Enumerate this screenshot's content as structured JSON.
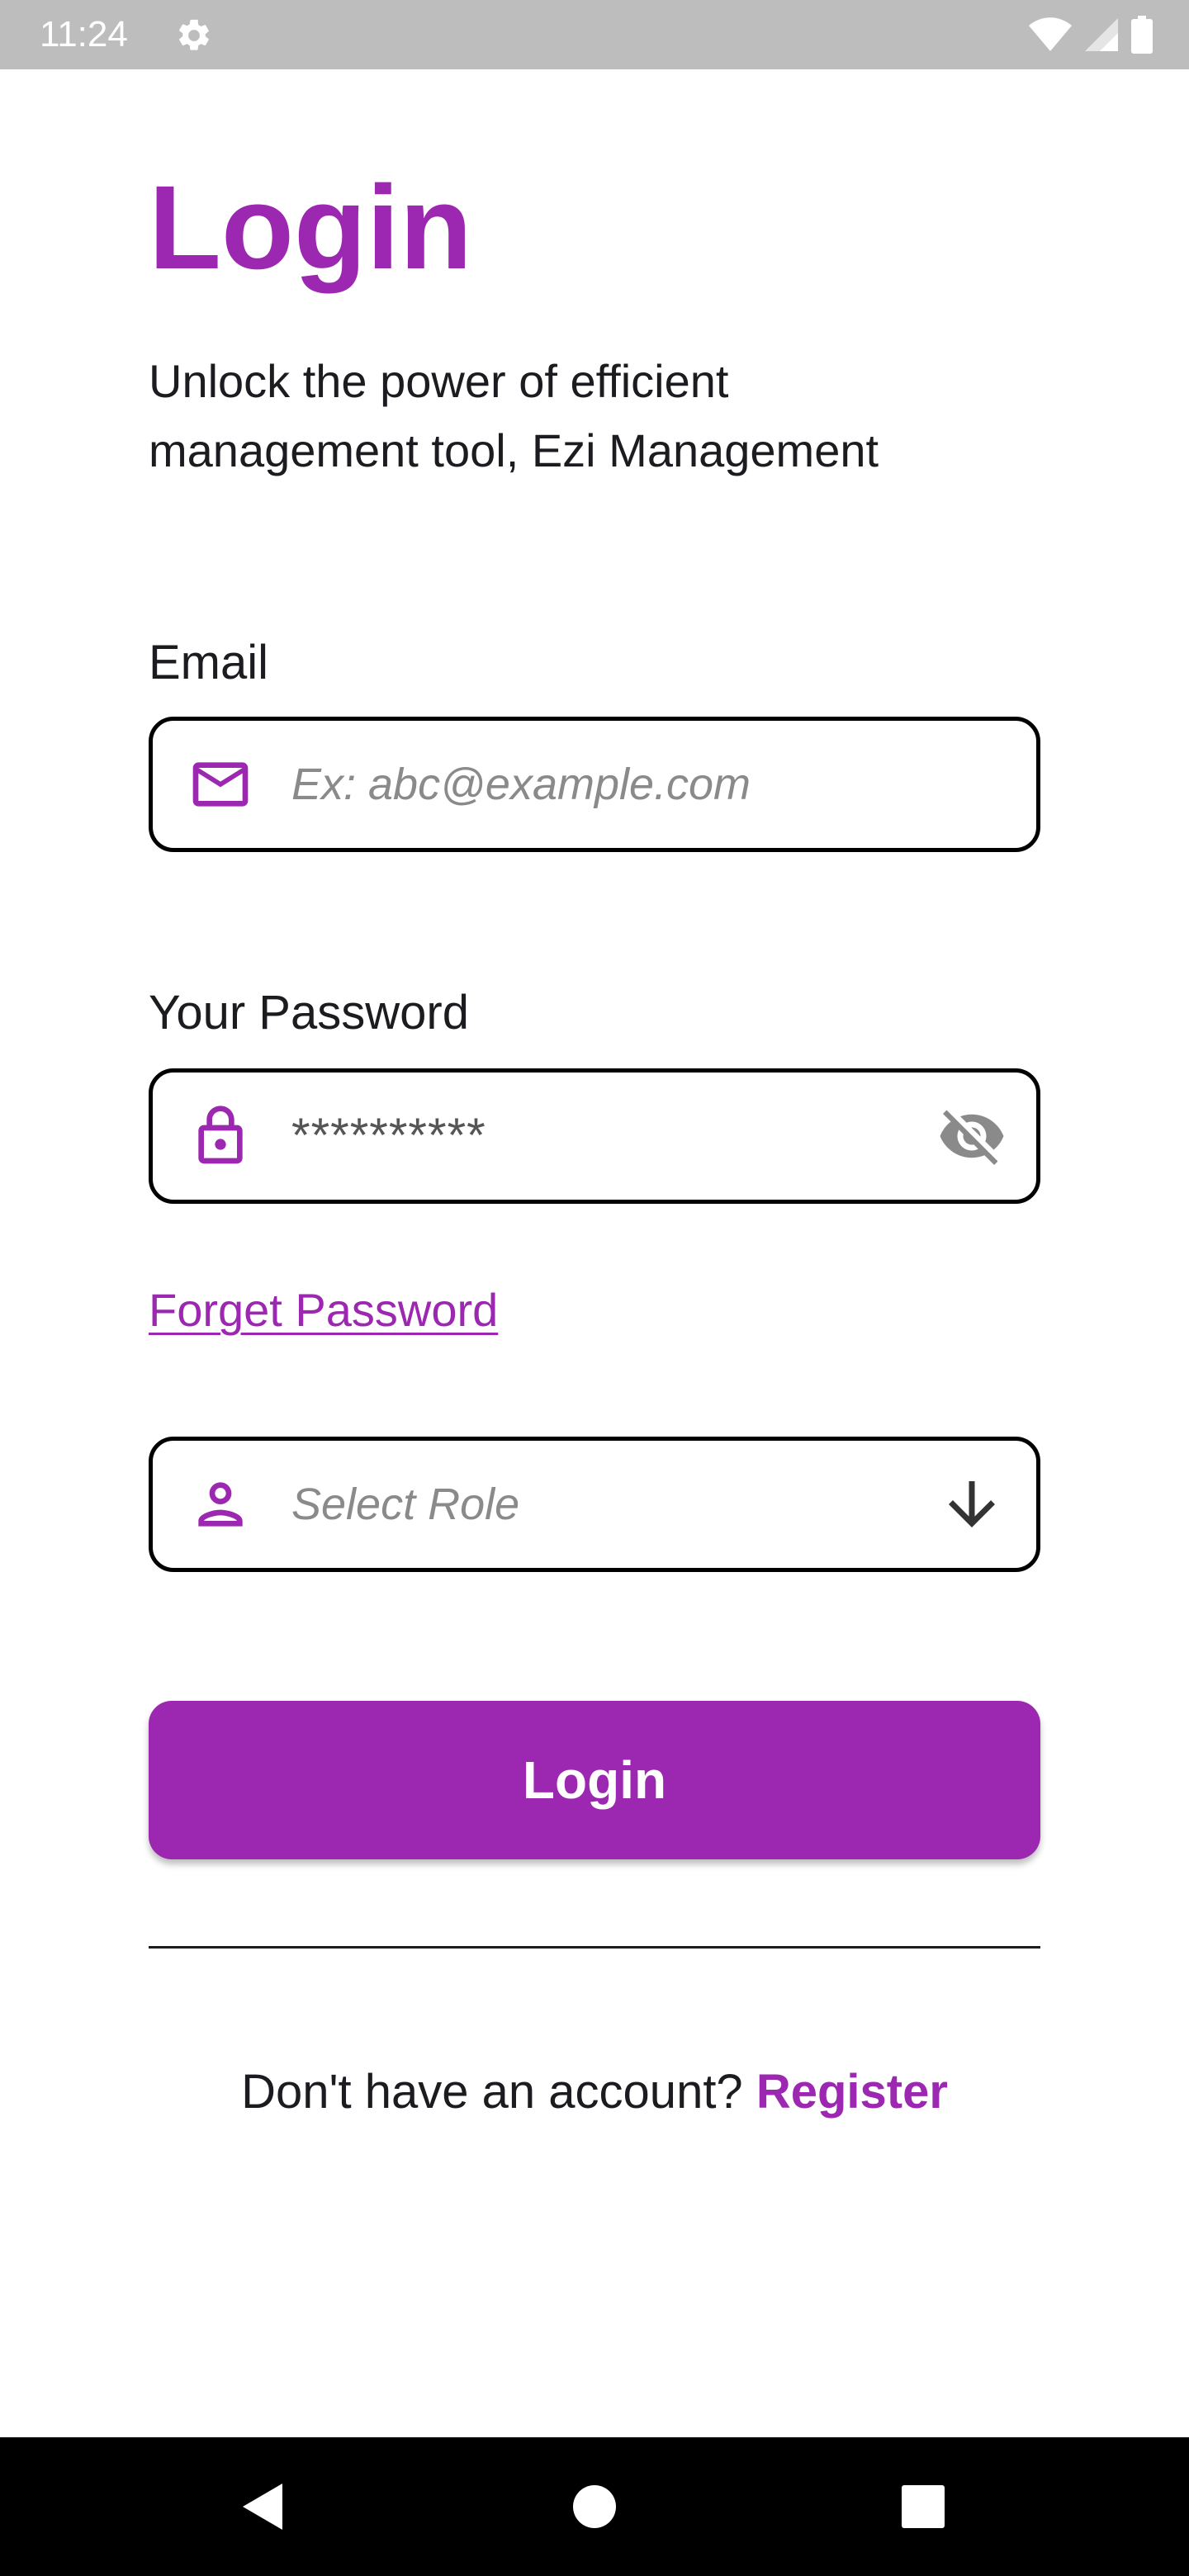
{
  "status_bar": {
    "time": "11:24",
    "icons": [
      "settings-gear-icon",
      "wifi-icon",
      "cell-signal-icon",
      "battery-icon"
    ]
  },
  "header": {
    "title": "Login",
    "subtitle": "Unlock the power of efficient management tool, Ezi Management"
  },
  "form": {
    "email": {
      "label": "Email",
      "placeholder": "Ex: abc@example.com",
      "value": "",
      "icon": "mail-icon"
    },
    "password": {
      "label": "Your Password",
      "value": "**********",
      "icon": "lock-icon",
      "visibility_icon": "eye-off-icon"
    },
    "forget_password_label": "Forget Password",
    "role": {
      "placeholder": "Select Role",
      "value": "",
      "icon": "person-icon",
      "trailing_icon": "arrow-down-icon"
    },
    "submit_label": "Login"
  },
  "footer": {
    "prompt": "Don't have an account?",
    "register_label": "Register"
  },
  "nav_bar": {
    "buttons": [
      "back-icon",
      "home-icon",
      "recents-icon"
    ]
  },
  "colors": {
    "accent": "#9c27b0",
    "text": "#1c1b1f",
    "placeholder": "#8a8a8a",
    "status_bar": "#bdbdbd",
    "nav_bar": "#000000"
  }
}
